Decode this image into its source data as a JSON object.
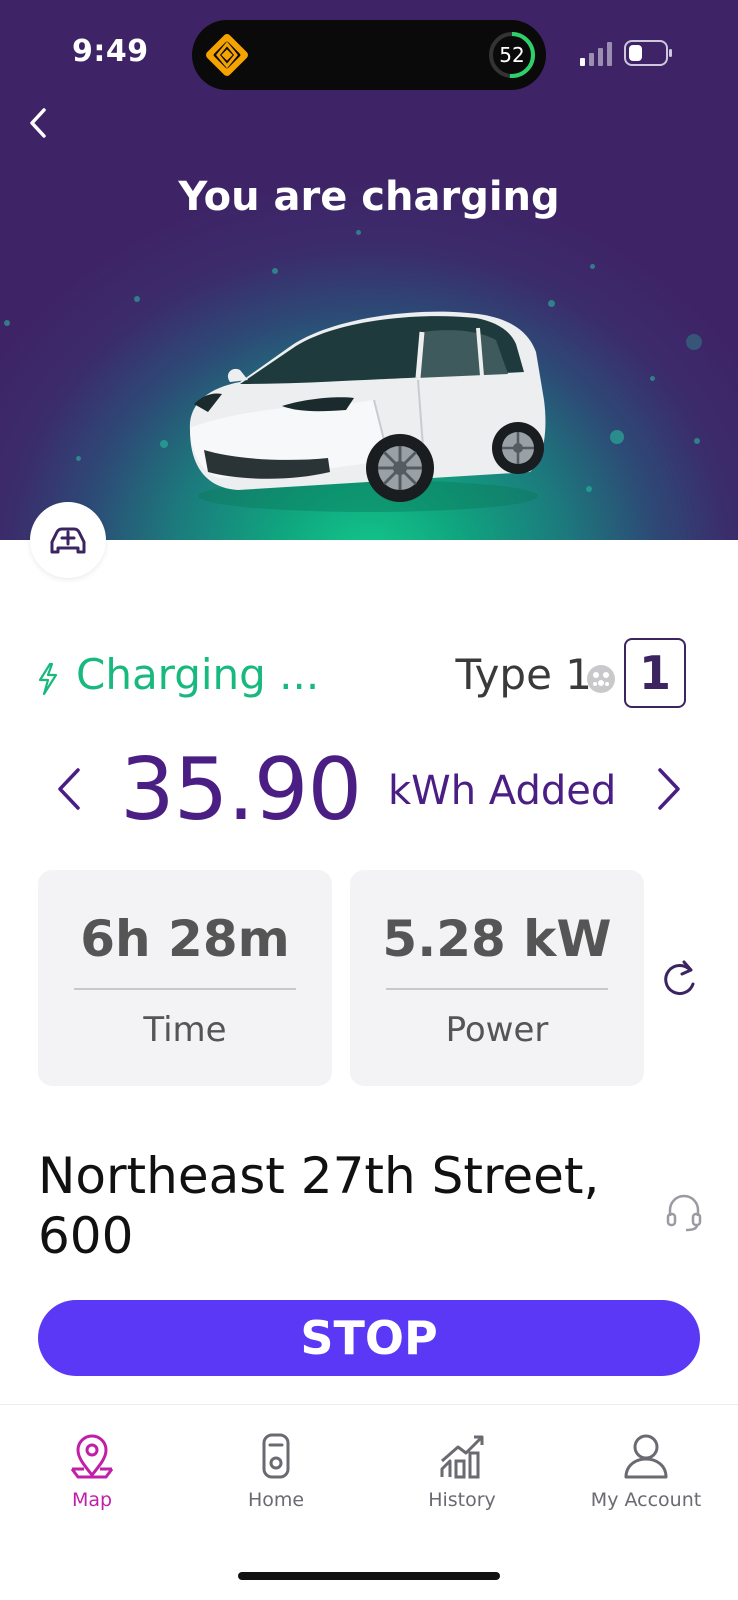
{
  "status_bar": {
    "time": "9:49",
    "ring_value": "52"
  },
  "hero": {
    "title": "You are charging"
  },
  "session": {
    "status": "Charging ...",
    "connector_type": "Type 1",
    "port_number": "1",
    "energy_value": "35.90",
    "energy_unit": "kWh Added"
  },
  "stats": [
    {
      "value": "6h 28m",
      "label": "Time"
    },
    {
      "value": "5.28 kW",
      "label": "Power"
    }
  ],
  "location": {
    "address": "Northeast 27th Street, 600"
  },
  "actions": {
    "stop_label": "STOP"
  },
  "tabbar": {
    "items": [
      {
        "label": "Map",
        "icon": "map-pin-icon",
        "active": true
      },
      {
        "label": "Home",
        "icon": "charger-icon",
        "active": false
      },
      {
        "label": "History",
        "icon": "chart-icon",
        "active": false
      },
      {
        "label": "My Account",
        "icon": "person-icon",
        "active": false
      }
    ]
  },
  "colors": {
    "accent_purple": "#4a1e82",
    "charging_green": "#18b97e",
    "stop_button": "#5a38f5",
    "active_tab": "#c21fa8"
  }
}
